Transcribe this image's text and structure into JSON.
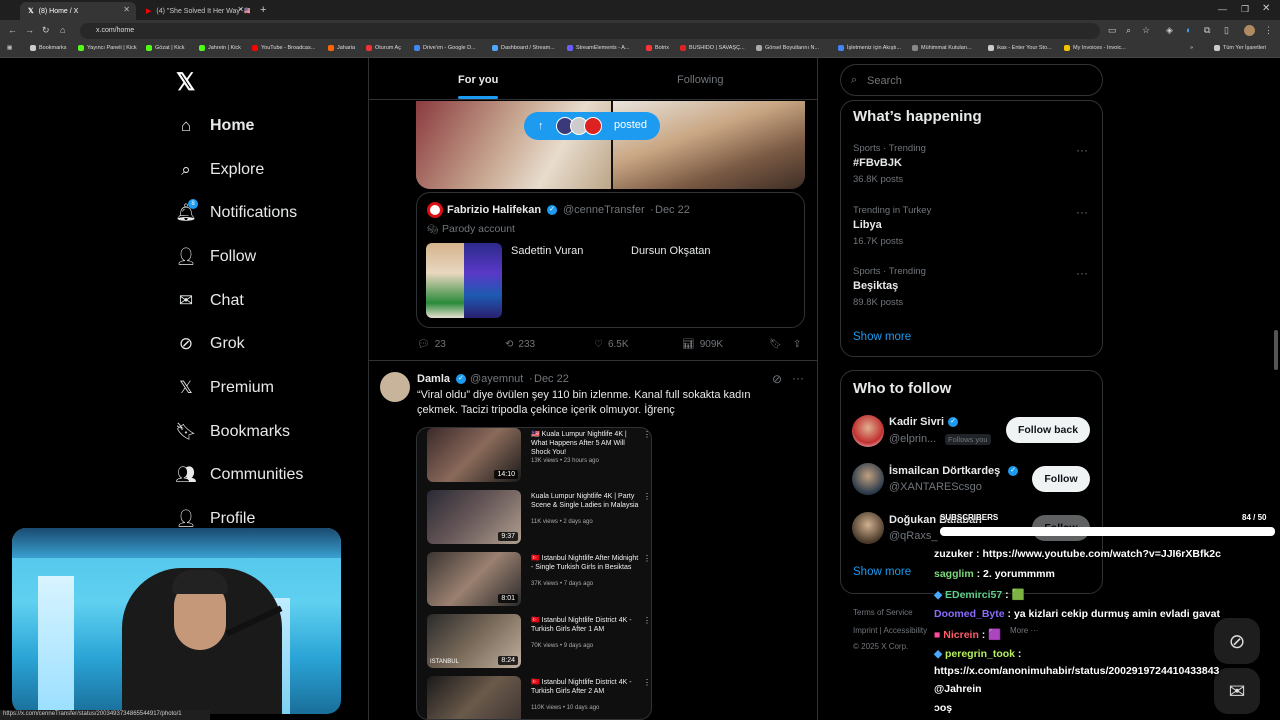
{
  "browser": {
    "tabs": [
      {
        "label": "(8) Home / X",
        "active": true
      },
      {
        "label": "(4) \"She Solved It Her Way\" 🇺🇸🇬🇧",
        "active": false
      }
    ],
    "url": "x.com/home",
    "bookmarks": [
      "Bookmarks",
      "Yayıncı Paneli | Kick",
      "Gözat | Kick",
      "Jahrein | Kick",
      "YouTube - Broadcas...",
      "Jaharia",
      "Oturum Aç",
      "Drive'ım - Google D...",
      "Dashboard / Stream...",
      "StreamElements - A...",
      "Botrix",
      "BUSHIDO | SAVAŞÇ...",
      "Görsel Boyutlarını N...",
      "İşletmeniz için Akıştı...",
      "Mühimmat Kutuları...",
      "ikas - Enter Your Sto...",
      "My Invoices - Invoic...",
      "Tüm Yer İşaretleri"
    ],
    "status_url": "https://x.com/cenneTransfer/status/2003493734865544917/photo/1"
  },
  "sidebar": {
    "logo_icon": "x-logo-icon",
    "items": [
      {
        "label": "Home",
        "icon": "home-icon",
        "active": true
      },
      {
        "label": "Explore",
        "icon": "search-icon"
      },
      {
        "label": "Notifications",
        "icon": "bell-icon",
        "badge": "8"
      },
      {
        "label": "Follow",
        "icon": "person-add-icon"
      },
      {
        "label": "Chat",
        "icon": "mail-icon"
      },
      {
        "label": "Grok",
        "icon": "grok-icon"
      },
      {
        "label": "Premium",
        "icon": "x-logo-icon"
      },
      {
        "label": "Bookmarks",
        "icon": "bookmark-icon"
      },
      {
        "label": "Communities",
        "icon": "people-icon"
      },
      {
        "label": "Profile",
        "icon": "person-icon"
      }
    ]
  },
  "feed": {
    "tabs": [
      "For you",
      "Following"
    ],
    "posted_pill": "posted",
    "quote": {
      "name": "Fabrizio Halifekan",
      "handle": "@cenneTransfer",
      "date": "Dec 22",
      "parody": "Parody account",
      "label1": "Sadettin Vuran",
      "label2": "Dursun Okşatan"
    },
    "actions1": {
      "replies": "23",
      "reposts": "233",
      "likes": "6.5K",
      "views": "909K"
    },
    "post2": {
      "name": "Damla",
      "handle": "@ayemnut",
      "date": "Dec 22",
      "text_line1": "“Viral oldu” diye övülen şey 110 bin izlenme. Kanal full sokakta kadın",
      "text_line2": "çekmek. Tacizi tripodla çekince içerik olmuyor. İğrenç"
    },
    "videos": [
      {
        "title": "🇲🇾 Kuala Lumpur Nightlife 4K | What Happens After 5 AM Will Shock You!",
        "meta": "13K views • 23 hours ago",
        "duration": "14:10"
      },
      {
        "title": "Kuala Lumpur Nightlife 4K | Party Scene & Single Ladies in Malaysia",
        "meta": "11K views • 2 days ago",
        "duration": "9:37"
      },
      {
        "title": "🇹🇷 Istanbul Nightlife After Midnight - Single Turkish Girls in Besiktas",
        "meta": "37K views • 7 days ago",
        "duration": "8:01"
      },
      {
        "title": "🇹🇷 Istanbul Nightlife District 4K - Turkish Girls After 1 AM",
        "meta": "70K views • 9 days ago",
        "duration": "8:24"
      },
      {
        "title": "🇹🇷 Istanbul Nightlife District 4K - Turkish Girls After 2 AM",
        "meta": "110K views • 10 days ago",
        "duration": ""
      }
    ],
    "thumb_text": "ISTANBUL"
  },
  "right": {
    "search_placeholder": "Search",
    "happening_title": "What’s happening",
    "trends": [
      {
        "category": "Sports · Trending",
        "title": "#FBvBJK",
        "posts": "36.8K posts"
      },
      {
        "category": "Trending in Turkey",
        "title": "Libya",
        "posts": "16.7K posts"
      },
      {
        "category": "Sports · Trending",
        "title": "Beşiktaş",
        "posts": "89.8K posts"
      }
    ],
    "show_more": "Show more",
    "who_title": "Who to follow",
    "who": [
      {
        "name": "Kadir Sivri",
        "handle": "@elprin...",
        "badge": "Follows you",
        "button": "Follow back"
      },
      {
        "name": "İsmailcan Dörtkardeş",
        "handle": "@XANTARES​csgo",
        "button": "Follow"
      },
      {
        "name": "Doğukan Balaban",
        "handle": "@qRaxs_",
        "button": "Follow"
      }
    ],
    "footer_line1": "Terms of Service",
    "footer_line2": "Imprint  |  Accessibility",
    "footer_line3": "© 2025 X Corp.",
    "footer_more": "More ···"
  },
  "overlay": {
    "subscribers_label": "SUBSCRIBERS",
    "subscribers_count": "84 / 50",
    "chat": [
      {
        "user": "zuzuker",
        "msg": "https://www.youtube.com/watch?v=JJI6rXBfk2c",
        "color": "#ffffff"
      },
      {
        "user": "sagglim",
        "msg": "2. yorummmm",
        "color": "#7dd97d"
      },
      {
        "user": "EDemirci57",
        "msg": "🟩",
        "color": "#5fd08a"
      },
      {
        "user": "Doomed_Byte",
        "msg": "ya kizlari cekip durmuş amin evladi gavat",
        "color": "#8a6cff"
      },
      {
        "user": "Nicrein",
        "msg": "🟪",
        "color": "#ff5c6c"
      },
      {
        "user": "peregrin_took",
        "msg": "",
        "color": "#b6f05a"
      },
      {
        "user": "",
        "msg": "https://x.com/anonimuhabir/status/2002919724410433843",
        "color": "#ffffff"
      },
      {
        "user": "",
        "msg": "@Jahrein",
        "color": "#ffffff"
      },
      {
        "user": "",
        "msg": "ɔoş",
        "color": "#ffffff"
      }
    ]
  }
}
